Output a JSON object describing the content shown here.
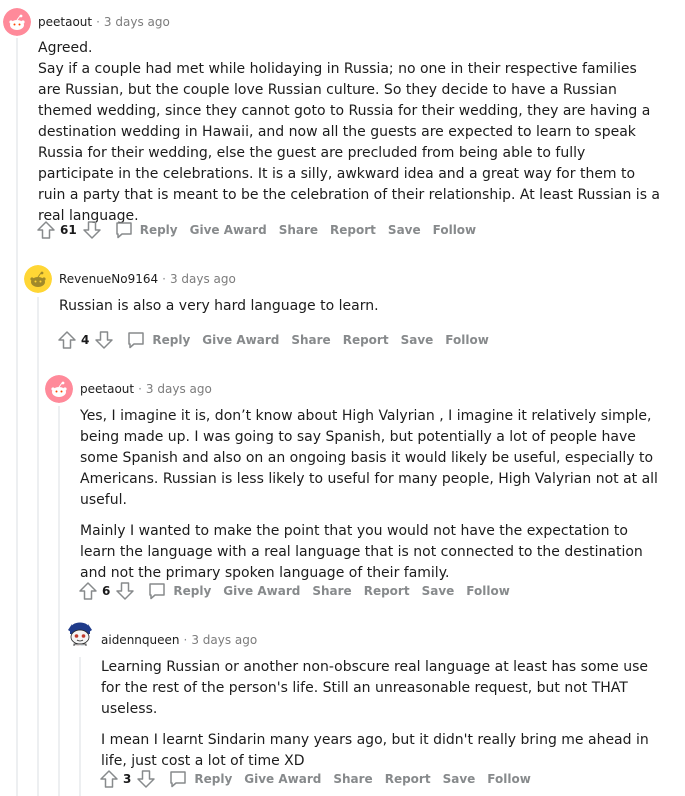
{
  "comments": [
    {
      "author": "peetaout",
      "time": "3 days ago",
      "paragraphs": [
        "Agreed.",
        "Say if a couple had met while holidaying in Russia; no one in their respective families are Russian, but the couple love Russian culture. So they decide to have a Russian themed wedding, since they cannot goto to Russia for their wedding, they are having a destination wedding in Hawaii, and now all the guests are expected to learn to speak Russia for their wedding, else the guest are precluded from being able to fully participate in the celebrations. It is a silly, awkward idea and a great way for them to ruin a party that is meant to be the celebration of their relationship. At least Russian is a real language."
      ],
      "score": "61"
    },
    {
      "author": "RevenueNo9164",
      "time": "3 days ago",
      "paragraphs": [
        "Russian is also a very hard language to learn."
      ],
      "score": "4"
    },
    {
      "author": "peetaout",
      "time": "3 days ago",
      "paragraphs": [
        "Yes, I imagine it is, don’t know about High Valyrian , I imagine it relatively simple, being made up. I was going to say Spanish, but potentially a lot of people have some Spanish and also on an ongoing basis it would likely be useful, especially to Americans. Russian is less likely to useful for many people, High Valyrian not at all useful.",
        "Mainly I wanted to make the point that you would not have the expectation to learn the language with a real language that is not connected to the destination and not the primary spoken language of their family."
      ],
      "score": "6"
    },
    {
      "author": "aidennqueen",
      "time": "3 days ago",
      "paragraphs": [
        "Learning Russian or another non-obscure real language at least has some use for the rest of the person's life. Still an unreasonable request, but not THAT useless.",
        "I mean I learnt Sindarin many years ago, but it didn't really bring me ahead in life, just cost a lot of time XD"
      ],
      "score": "3"
    }
  ],
  "actions": {
    "reply": "Reply",
    "give_award": "Give Award",
    "share": "Share",
    "report": "Report",
    "save": "Save",
    "follow": "Follow"
  },
  "meta_separator": "·",
  "colors": {
    "avatar_pink": "#ff8a9a",
    "avatar_yellow": "#ffd635",
    "meta_gray": "#7c7c7c",
    "action_gray": "#878a8c",
    "thread_line": "#edeff1"
  }
}
